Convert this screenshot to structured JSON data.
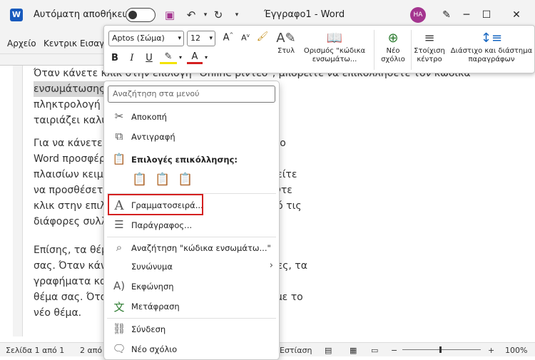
{
  "titlebar": {
    "app_icon": "word-icon",
    "autosave_label": "Αυτόματη αποθήκευση",
    "doc_title": "Έγγραφο1 - Word",
    "avatar_initials": "HA",
    "avatar_color": "#a4358f"
  },
  "ribbon": {
    "tabs": [
      "Αρχείο",
      "Κεντρικ",
      "Εισαγ"
    ]
  },
  "minitoolbar": {
    "font_name": "Aptos (Σώμα)",
    "font_size": "12",
    "styles_label": "Στυλ",
    "define_label_1": "Ορισμός \"κώδικα",
    "define_label_2": "ενσωμάτω...",
    "new_comment_1": "Νέο",
    "new_comment_2": "σχόλιο",
    "center_1": "Στοίχιση",
    "center_2": "κέντρο",
    "spacing_1": "Διάστιχο και διάστημα",
    "spacing_2": "παραγράφων",
    "bold": "B",
    "italic": "I",
    "underline": "U",
    "grow": "A",
    "shrink": "A"
  },
  "document": {
    "para1": [
      "Όταν κάνετε κλικ στην επιλογή \"Online βίντεο\", μπορείτε να επικολλήσετε τον κώδικα",
      "ενσωμάτωσης                                           ρσετε. Μπορείτε, επίσης, να",
      "πληκτρολογή                                           ε στο Internet το βίντεο που",
      "ταιριάζει καλύ"
    ],
    "para2": [
      "Για να κάνετε τ                                          ιουργήθηκε από επαγγελματία, το",
      "Word προσφέρ                                          ν, συνοδευτικών σελίδων και",
      "πλαισίων κειμε                                          α το άλλο. Για παράδειγμα, μπορείτε",
      "να προσθέσετ                                           , κεφαλίδα και πλαϊνή γραμμή. Κάντε",
      "κλικ στην επιλ                                           ιλέξτε τα στοιχεία που θέλετε από τις",
      "διάφορες συλλ"
    ],
    "para3": [
      "Επίσης, τα θέμ                                           ηρείτε συντονισμένο το έγγραφό",
      "σας. Όταν κάνε                                           επιλέξετε ένα νέο θέμα, οι εικόνες, τα",
      "γραφήματα κα                                           κειμένου να συμφωνούν με το νέο",
      "θέμα σας. Ότα                                           σας αλλάζουν για να ταιριάζουν με το",
      "νέο θέμα."
    ]
  },
  "context_menu": {
    "search_placeholder": "Αναζήτηση στα μενού",
    "cut": "Αποκοπή",
    "copy": "Αντιγραφή",
    "paste_options": "Επιλογές επικόλλησης:",
    "font": "Γραμματοσειρά...",
    "paragraph": "Παράγραφος...",
    "search_item": "Αναζήτηση \"κώδικα ενσωμάτω...\"",
    "synonyms": "Συνώνυμα",
    "read_aloud": "Εκφώνηση",
    "translate": "Μετάφραση",
    "link": "Σύνδεση",
    "new_comment": "Νέο σχόλιο"
  },
  "statusbar": {
    "page": "Σελίδα 1 από 1",
    "words": "2 από 2",
    "focus": "Εστίαση",
    "zoom": "100%"
  },
  "colors": {
    "highlight_box": "#d42020",
    "word_blue": "#185abd"
  }
}
